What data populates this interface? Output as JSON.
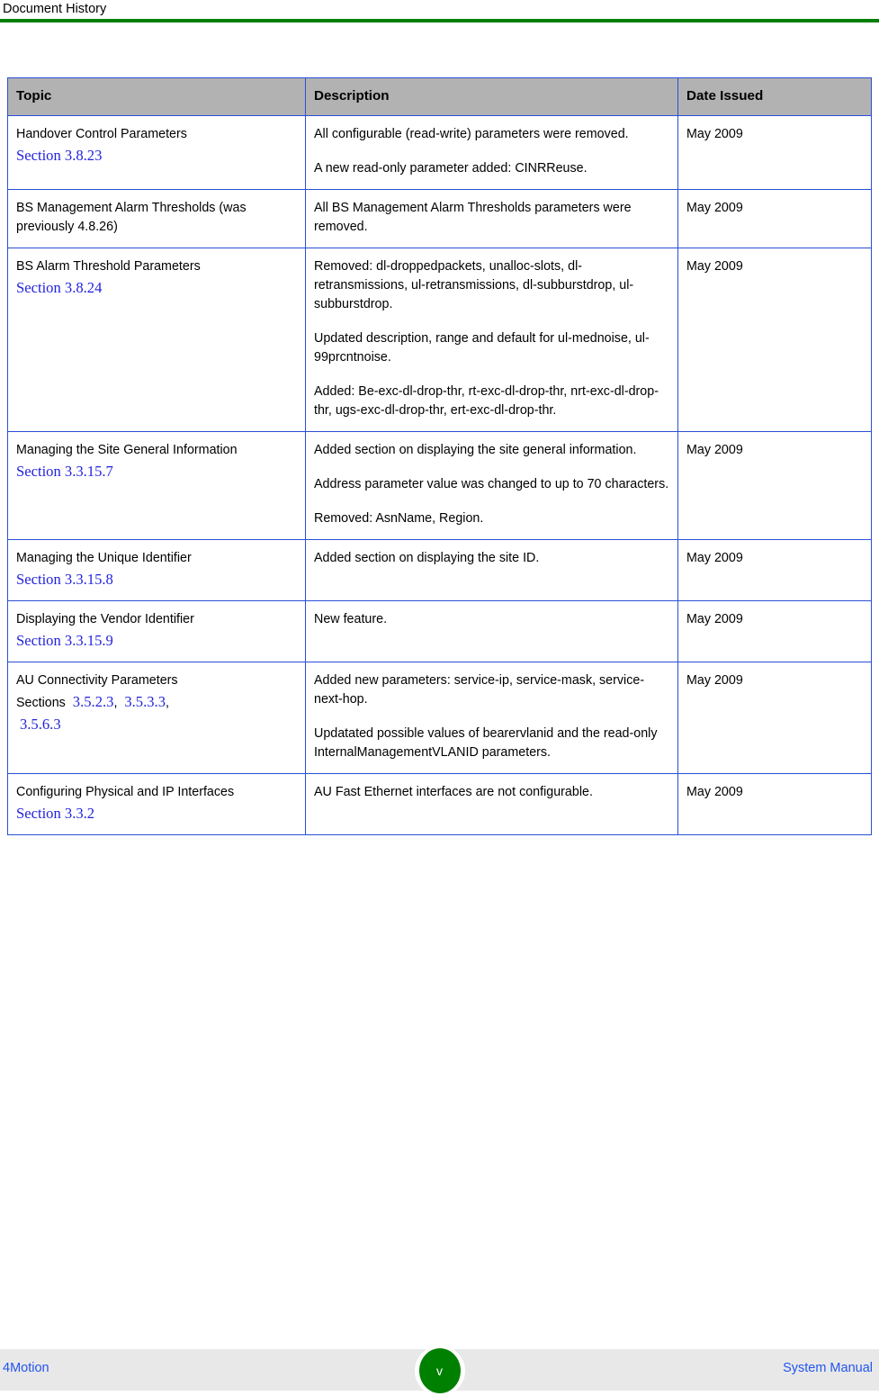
{
  "header": {
    "title": "Document History",
    "rule_color": "#008000"
  },
  "table": {
    "columns": [
      "Topic",
      "Description",
      "Date Issued"
    ],
    "header_background": "#b2b2b2",
    "border_color": "#2a4fd6",
    "link_color": "#2222dd",
    "rows": [
      {
        "topic_title": "Handover Control Parameters",
        "section_label": "Section 3.8.23",
        "description": [
          "All configurable (read-write) parameters were removed.",
          "A new read-only parameter added: CINRReuse."
        ],
        "date": "May 2009"
      },
      {
        "topic_title": "BS Management Alarm Thresholds (was previously 4.8.26)",
        "section_label": "",
        "description": [
          "All BS Management Alarm Thresholds parameters were removed."
        ],
        "date": "May 2009"
      },
      {
        "topic_title": "BS Alarm Threshold Parameters",
        "section_label": "Section 3.8.24",
        "description": [
          "Removed: dl-droppedpackets, unalloc-slots, dl-retransmissions, ul-retransmissions, dl-subburstdrop, ul-subburstdrop.",
          "Updated description, range and default for ul-mednoise, ul-99prcntnoise.",
          "Added: Be-exc-dl-drop-thr, rt-exc-dl-drop-thr, nrt-exc-dl-drop-thr, ugs-exc-dl-drop-thr, ert-exc-dl-drop-thr."
        ],
        "date": "May 2009"
      },
      {
        "topic_title": "Managing the Site General Information",
        "section_label": "Section 3.3.15.7",
        "description": [
          "Added section on displaying the site general information.",
          "Address parameter value was changed to up to 70 characters.",
          "Removed: AsnName, Region."
        ],
        "date": "May 2009"
      },
      {
        "topic_title": "Managing the Unique Identifier",
        "section_label": "Section 3.3.15.8",
        "description": [
          "Added section on displaying the site ID."
        ],
        "date": "May 2009"
      },
      {
        "topic_title": "Displaying the Vendor Identifier",
        "section_label": "Section 3.3.15.9",
        "description": [
          "New feature."
        ],
        "date": "May 2009"
      },
      {
        "topic_title": "AU Connectivity Parameters",
        "sections_prefix": "Sections",
        "section_numbers": [
          "3.5.2.3",
          "3.5.3.3",
          "3.5.6.3"
        ],
        "description": [
          "Added new parameters: service-ip, service-mask, service-next-hop.",
          "Updatated possible values of bearervlanid and the read-only InternalManagementVLANID parameters."
        ],
        "date": "May 2009"
      },
      {
        "topic_title": "Configuring Physical and IP Interfaces",
        "section_label": "Section 3.3.2",
        "description": [
          "AU Fast Ethernet interfaces are not configurable."
        ],
        "date": "May 2009"
      }
    ]
  },
  "footer": {
    "left_label": "4Motion",
    "right_label": "System Manual",
    "page_number": "v",
    "badge_color": "#008000"
  }
}
